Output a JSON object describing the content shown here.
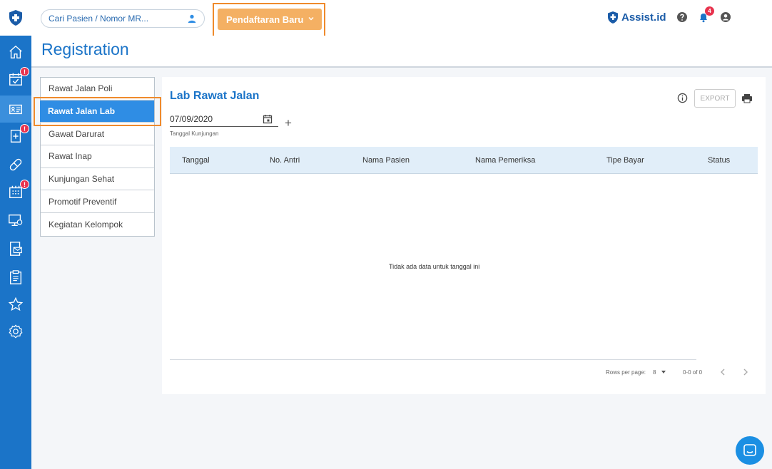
{
  "header": {
    "search_placeholder": "Cari Pasien / Nomor MR...",
    "register_label": "Pendaftaran Baru",
    "brand_name": "Assist.id",
    "notification_count": "4"
  },
  "sidebar": {
    "items": [
      {
        "icon": "home-icon",
        "badge": null
      },
      {
        "icon": "calendar-check-icon",
        "badge": "!"
      },
      {
        "icon": "registration-card-icon",
        "badge": null,
        "active": true
      },
      {
        "icon": "medical-record-icon",
        "badge": "!"
      },
      {
        "icon": "pill-icon",
        "badge": null
      },
      {
        "icon": "pharmacy-icon",
        "badge": "!"
      },
      {
        "icon": "computer-icon",
        "badge": null
      },
      {
        "icon": "mail-document-icon",
        "badge": null
      },
      {
        "icon": "clipboard-icon",
        "badge": null
      },
      {
        "icon": "star-icon",
        "badge": null
      },
      {
        "icon": "settings-icon",
        "badge": null
      }
    ]
  },
  "page": {
    "title": "Registration"
  },
  "subnav": {
    "items": [
      {
        "label": "Rawat Jalan Poli"
      },
      {
        "label": "Rawat Jalan Lab",
        "active": true
      },
      {
        "label": "Gawat Darurat"
      },
      {
        "label": "Rawat Inap"
      },
      {
        "label": "Kunjungan Sehat"
      },
      {
        "label": "Promotif Preventif"
      },
      {
        "label": "Kegiatan Kelompok"
      }
    ]
  },
  "main": {
    "title": "Lab Rawat Jalan",
    "export_label": "EXPORT",
    "date_value": "07/09/2020",
    "date_label": "Tanggal Kunjungan",
    "plus": "+",
    "columns": [
      "Tanggal",
      "No. Antri",
      "Nama Pasien",
      "Nama Pemeriksa",
      "Tipe Bayar",
      "Status"
    ],
    "empty_message": "Tidak ada data untuk tanggal ini",
    "pagination": {
      "rows_per_page_label": "Rows per page:",
      "rows_per_page_value": "8",
      "range": "0-0 of 0"
    }
  },
  "colors": {
    "primary": "#1b74c8",
    "accent": "#f4b063",
    "highlight": "#ef8a2c",
    "badge": "#e8334e"
  }
}
